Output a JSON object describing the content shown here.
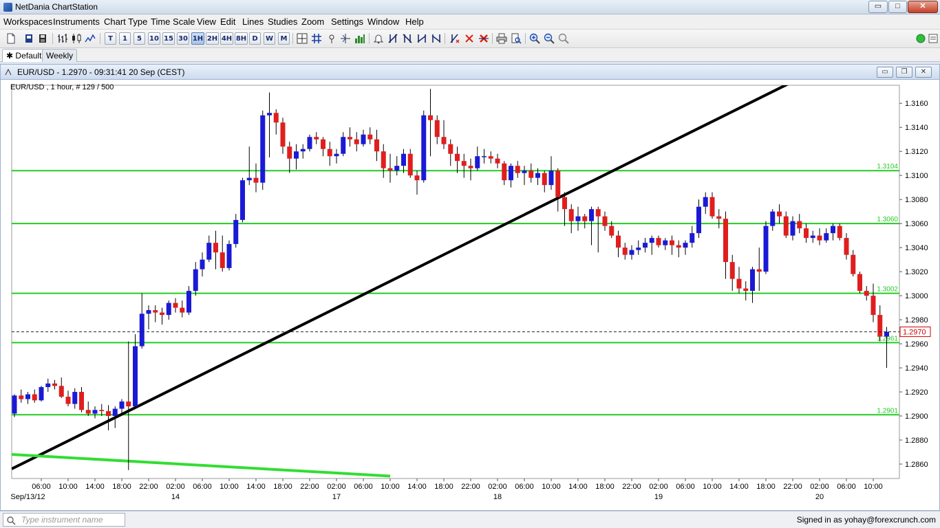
{
  "window": {
    "title": "NetDania ChartStation",
    "controls": {
      "minimize": "▭",
      "maximize": "□",
      "close": "✕"
    }
  },
  "menu": [
    "Workspaces",
    "Instruments",
    "Chart Type",
    "Time Scale",
    "View",
    "Edit",
    "Lines",
    "Studies",
    "Zoom",
    "Settings",
    "Window",
    "Help"
  ],
  "toolbar": {
    "timeframes": [
      "T",
      "1",
      "5",
      "10",
      "15",
      "30",
      "1H",
      "2H",
      "4H",
      "8H",
      "D",
      "W",
      "M"
    ],
    "active_timeframe": "1H",
    "icons": [
      "new-chart-icon",
      "open-icon",
      "save-icon",
      "bar-chart-icon",
      "candlestick-icon",
      "line-chart-icon",
      "crosshair-icon",
      "grid-icon",
      "cursor-icon",
      "volume-icon",
      "bell-icon",
      "trendline-tools-icon",
      "delete-line-icon",
      "delete-all-icon",
      "print-icon",
      "print-preview-icon",
      "zoom-in-icon",
      "zoom-out-icon",
      "zoom-reset-icon",
      "connection-status-icon"
    ]
  },
  "workspace_tabs": [
    {
      "label": "Default",
      "active": true
    },
    {
      "label": "Weekly",
      "active": false
    }
  ],
  "chart_window": {
    "title": "EUR/USD - 1.2970 - 09:31:41  20 Sep (CEST)",
    "controls": {
      "minimize": "▭",
      "restore": "❐",
      "close": "✕"
    }
  },
  "chart_data": {
    "type": "candlestick",
    "title": "",
    "info_label": "EUR/USD , 1 hour, # 129 / 500",
    "symbol": "EUR/USD",
    "interval": "1 hour",
    "bar_count": "129 / 500",
    "ylim": [
      1.2848,
      1.3175
    ],
    "y_ticks": [
      1.286,
      1.288,
      1.29,
      1.292,
      1.294,
      1.296,
      1.298,
      1.3,
      1.302,
      1.304,
      1.306,
      1.308,
      1.31,
      1.312,
      1.314,
      1.316
    ],
    "y_tick_labels": [
      "1.2860",
      "1.2880",
      "1.2900",
      "1.2920",
      "1.2940",
      "1.2960",
      "1.2980",
      "1.3000",
      "1.3020",
      "1.3040",
      "1.3060",
      "1.3080",
      "1.3100",
      "1.3120",
      "1.3140",
      "1.3160"
    ],
    "x_tick_labels": [
      "06:00",
      "10:00",
      "14:00",
      "18:00",
      "22:00",
      "02:00",
      "06:00",
      "10:00",
      "14:00",
      "18:00",
      "22:00",
      "02:00",
      "06:00",
      "10:00",
      "14:00",
      "18:00",
      "22:00",
      "02:00",
      "06:00",
      "10:00",
      "14:00",
      "18:00",
      "22:00",
      "02:00",
      "06:00",
      "10:00",
      "14:00",
      "18:00",
      "22:00",
      "02:00",
      "06:00",
      "10:00"
    ],
    "x_tick_bars": [
      4,
      8,
      12,
      16,
      20,
      24,
      28,
      32,
      36,
      40,
      44,
      48,
      52,
      56,
      60,
      64,
      68,
      72,
      76,
      80,
      84,
      88,
      92,
      96,
      100,
      104,
      108,
      112,
      116,
      120,
      124,
      128
    ],
    "date_labels": [
      {
        "label": "Sep/13/12",
        "bar": 2
      },
      {
        "label": "14",
        "bar": 24
      },
      {
        "label": "17",
        "bar": 48
      },
      {
        "label": "18",
        "bar": 72
      },
      {
        "label": "19",
        "bar": 96
      },
      {
        "label": "20",
        "bar": 120
      }
    ],
    "last_price": 1.297,
    "last_price_label": "1.2970",
    "horizontal_levels": [
      {
        "value": 1.3104,
        "label": "1.3104"
      },
      {
        "value": 1.306,
        "label": "1.3060"
      },
      {
        "value": 1.3002,
        "label": "1.3002"
      },
      {
        "value": 1.2961,
        "label": "1.2961"
      },
      {
        "value": 1.2901,
        "label": "1.2901"
      }
    ],
    "trendlines": [
      {
        "color": "#000000",
        "from": {
          "bar": 0,
          "price": 1.2856
        },
        "to": {
          "bar": 116,
          "price": 1.3178
        }
      },
      {
        "color": "#33dd33",
        "from": {
          "bar": 0,
          "price": 1.2868
        },
        "to": {
          "bar": 56,
          "price": 1.285
        }
      }
    ],
    "colors": {
      "up": "#1a1ad6",
      "down": "#e01e1e",
      "level": "#22cc22",
      "trendline": "#000000",
      "last_price": "#cc0000"
    },
    "candles": [
      [
        1.2902,
        1.2918,
        1.2899,
        1.2917
      ],
      [
        1.2917,
        1.2922,
        1.2911,
        1.2914
      ],
      [
        1.2914,
        1.292,
        1.291,
        1.2918
      ],
      [
        1.2918,
        1.2922,
        1.2911,
        1.2913
      ],
      [
        1.2913,
        1.2925,
        1.2912,
        1.2924
      ],
      [
        1.2924,
        1.2931,
        1.292,
        1.2927
      ],
      [
        1.2927,
        1.293,
        1.2922,
        1.2925
      ],
      [
        1.2925,
        1.2932,
        1.2915,
        1.2916
      ],
      [
        1.2916,
        1.2921,
        1.2908,
        1.291
      ],
      [
        1.291,
        1.2923,
        1.2906,
        1.292
      ],
      [
        1.292,
        1.2924,
        1.2903,
        1.2905
      ],
      [
        1.2905,
        1.2912,
        1.29,
        1.2902
      ],
      [
        1.2902,
        1.2908,
        1.2898,
        1.2905
      ],
      [
        1.2905,
        1.291,
        1.29,
        1.2904
      ],
      [
        1.2904,
        1.2909,
        1.2888,
        1.29
      ],
      [
        1.29,
        1.2908,
        1.289,
        1.2906
      ],
      [
        1.2906,
        1.2914,
        1.2902,
        1.2912
      ],
      [
        1.2912,
        1.2962,
        1.2855,
        1.2908
      ],
      [
        1.2908,
        1.2968,
        1.2906,
        1.2958
      ],
      [
        1.2958,
        1.3002,
        1.2956,
        1.2985
      ],
      [
        1.2985,
        1.2992,
        1.2972,
        1.2988
      ],
      [
        1.2988,
        1.2992,
        1.2978,
        1.2986
      ],
      [
        1.2986,
        1.299,
        1.2976,
        1.2984
      ],
      [
        1.2984,
        1.2996,
        1.298,
        1.2994
      ],
      [
        1.2994,
        1.2998,
        1.2986,
        1.299
      ],
      [
        1.299,
        1.2996,
        1.2982,
        1.2986
      ],
      [
        1.2986,
        1.3008,
        1.2984,
        1.3004
      ],
      [
        1.3004,
        1.3028,
        1.3,
        1.3022
      ],
      [
        1.3022,
        1.3036,
        1.3016,
        1.303
      ],
      [
        1.303,
        1.305,
        1.3028,
        1.3044
      ],
      [
        1.3044,
        1.3054,
        1.3022,
        1.3036
      ],
      [
        1.3036,
        1.305,
        1.302,
        1.3023
      ],
      [
        1.3023,
        1.3046,
        1.3021,
        1.3043
      ],
      [
        1.3043,
        1.3068,
        1.304,
        1.3063
      ],
      [
        1.3063,
        1.3098,
        1.3061,
        1.3096
      ],
      [
        1.3096,
        1.3124,
        1.3092,
        1.3098
      ],
      [
        1.3098,
        1.311,
        1.3086,
        1.3094
      ],
      [
        1.3094,
        1.3154,
        1.3088,
        1.315
      ],
      [
        1.315,
        1.3169,
        1.3115,
        1.3152
      ],
      [
        1.3152,
        1.3155,
        1.3134,
        1.3144
      ],
      [
        1.3144,
        1.3148,
        1.3118,
        1.3124
      ],
      [
        1.3124,
        1.3128,
        1.3102,
        1.3114
      ],
      [
        1.3114,
        1.3126,
        1.3105,
        1.312
      ],
      [
        1.312,
        1.3126,
        1.3114,
        1.3122
      ],
      [
        1.3122,
        1.3134,
        1.312,
        1.3132
      ],
      [
        1.3132,
        1.3136,
        1.3126,
        1.313
      ],
      [
        1.313,
        1.3132,
        1.3116,
        1.3122
      ],
      [
        1.3122,
        1.3128,
        1.3108,
        1.3116
      ],
      [
        1.3116,
        1.3122,
        1.311,
        1.3118
      ],
      [
        1.3118,
        1.3136,
        1.3116,
        1.3132
      ],
      [
        1.3132,
        1.314,
        1.3124,
        1.313
      ],
      [
        1.313,
        1.3136,
        1.312,
        1.3126
      ],
      [
        1.3126,
        1.3138,
        1.3124,
        1.3134
      ],
      [
        1.3134,
        1.314,
        1.3126,
        1.313
      ],
      [
        1.313,
        1.3138,
        1.3112,
        1.312
      ],
      [
        1.312,
        1.3126,
        1.3098,
        1.3106
      ],
      [
        1.3106,
        1.3118,
        1.3094,
        1.3104
      ],
      [
        1.3104,
        1.3116,
        1.31,
        1.3108
      ],
      [
        1.3108,
        1.3122,
        1.3102,
        1.3118
      ],
      [
        1.3118,
        1.3122,
        1.3098,
        1.31
      ],
      [
        1.31,
        1.3104,
        1.3084,
        1.3096
      ],
      [
        1.3096,
        1.3154,
        1.3094,
        1.315
      ],
      [
        1.315,
        1.3172,
        1.3116,
        1.3146
      ],
      [
        1.3146,
        1.315,
        1.3126,
        1.3132
      ],
      [
        1.3132,
        1.3146,
        1.3122,
        1.3126
      ],
      [
        1.3126,
        1.313,
        1.3108,
        1.3118
      ],
      [
        1.3118,
        1.3124,
        1.3102,
        1.3112
      ],
      [
        1.3112,
        1.3118,
        1.3098,
        1.3108
      ],
      [
        1.3108,
        1.3114,
        1.3096,
        1.3106
      ],
      [
        1.3106,
        1.3124,
        1.3104,
        1.3116
      ],
      [
        1.3116,
        1.3122,
        1.311,
        1.3116
      ],
      [
        1.3116,
        1.312,
        1.311,
        1.3114
      ],
      [
        1.3114,
        1.3118,
        1.3106,
        1.311
      ],
      [
        1.311,
        1.3112,
        1.3092,
        1.3096
      ],
      [
        1.3096,
        1.311,
        1.309,
        1.3108
      ],
      [
        1.3108,
        1.3112,
        1.3098,
        1.3102
      ],
      [
        1.3102,
        1.3108,
        1.3092,
        1.3104
      ],
      [
        1.3104,
        1.311,
        1.3094,
        1.3098
      ],
      [
        1.3098,
        1.3106,
        1.3092,
        1.3102
      ],
      [
        1.3102,
        1.3104,
        1.3086,
        1.3092
      ],
      [
        1.3092,
        1.3116,
        1.3088,
        1.3104
      ],
      [
        1.3104,
        1.3106,
        1.307,
        1.3082
      ],
      [
        1.3082,
        1.3086,
        1.3058,
        1.3072
      ],
      [
        1.3072,
        1.3076,
        1.3052,
        1.3062
      ],
      [
        1.3062,
        1.3074,
        1.3054,
        1.3066
      ],
      [
        1.3066,
        1.3068,
        1.3056,
        1.3062
      ],
      [
        1.3062,
        1.3074,
        1.3042,
        1.3072
      ],
      [
        1.3072,
        1.3074,
        1.3036,
        1.3066
      ],
      [
        1.3066,
        1.307,
        1.3054,
        1.3058
      ],
      [
        1.3058,
        1.3062,
        1.3048,
        1.305
      ],
      [
        1.305,
        1.3054,
        1.3032,
        1.304
      ],
      [
        1.304,
        1.3044,
        1.303,
        1.3034
      ],
      [
        1.3034,
        1.3042,
        1.303,
        1.3038
      ],
      [
        1.3038,
        1.3046,
        1.3034,
        1.304
      ],
      [
        1.304,
        1.3048,
        1.3036,
        1.3044
      ],
      [
        1.3044,
        1.305,
        1.3034,
        1.3048
      ],
      [
        1.3048,
        1.305,
        1.304,
        1.3042
      ],
      [
        1.3042,
        1.3048,
        1.3038,
        1.3046
      ],
      [
        1.3046,
        1.305,
        1.3034,
        1.3042
      ],
      [
        1.3042,
        1.3046,
        1.3032,
        1.304
      ],
      [
        1.304,
        1.3046,
        1.3034,
        1.3044
      ],
      [
        1.3044,
        1.3058,
        1.304,
        1.3052
      ],
      [
        1.3052,
        1.308,
        1.3048,
        1.3074
      ],
      [
        1.3074,
        1.3086,
        1.3068,
        1.3082
      ],
      [
        1.3082,
        1.3086,
        1.3064,
        1.3066
      ],
      [
        1.3066,
        1.3072,
        1.3056,
        1.3064
      ],
      [
        1.3064,
        1.307,
        1.3014,
        1.3028
      ],
      [
        1.3028,
        1.3034,
        1.3004,
        1.3014
      ],
      [
        1.3014,
        1.3024,
        1.3002,
        1.3006
      ],
      [
        1.3006,
        1.3012,
        1.2996,
        1.3004
      ],
      [
        1.3004,
        1.3024,
        1.2994,
        1.3022
      ],
      [
        1.3022,
        1.304,
        1.3004,
        1.302
      ],
      [
        1.302,
        1.3062,
        1.3018,
        1.3058
      ],
      [
        1.3058,
        1.3072,
        1.3054,
        1.307
      ],
      [
        1.307,
        1.3076,
        1.306,
        1.3066
      ],
      [
        1.3066,
        1.307,
        1.3048,
        1.305
      ],
      [
        1.305,
        1.3066,
        1.3046,
        1.3062
      ],
      [
        1.3062,
        1.3068,
        1.3052,
        1.3056
      ],
      [
        1.3056,
        1.306,
        1.3044,
        1.3048
      ],
      [
        1.3048,
        1.3054,
        1.3044,
        1.305
      ],
      [
        1.305,
        1.3056,
        1.3042,
        1.3046
      ],
      [
        1.3046,
        1.3056,
        1.3044,
        1.3052
      ],
      [
        1.3052,
        1.306,
        1.3046,
        1.3058
      ],
      [
        1.3058,
        1.306,
        1.3046,
        1.3048
      ],
      [
        1.3048,
        1.3052,
        1.303,
        1.3034
      ],
      [
        1.3034,
        1.3038,
        1.3016,
        1.3018
      ],
      [
        1.3018,
        1.302,
        1.3002,
        1.3004
      ],
      [
        1.3004,
        1.3008,
        1.2996,
        1.3
      ],
      [
        1.3,
        1.301,
        1.2978,
        1.2984
      ],
      [
        1.2984,
        1.2992,
        1.2962,
        1.2966
      ],
      [
        1.2966,
        1.2974,
        1.294,
        1.297
      ]
    ]
  },
  "status": {
    "search_placeholder": "Type instrument name",
    "signed_in": "Signed in as yohay@forexcrunch.com"
  }
}
